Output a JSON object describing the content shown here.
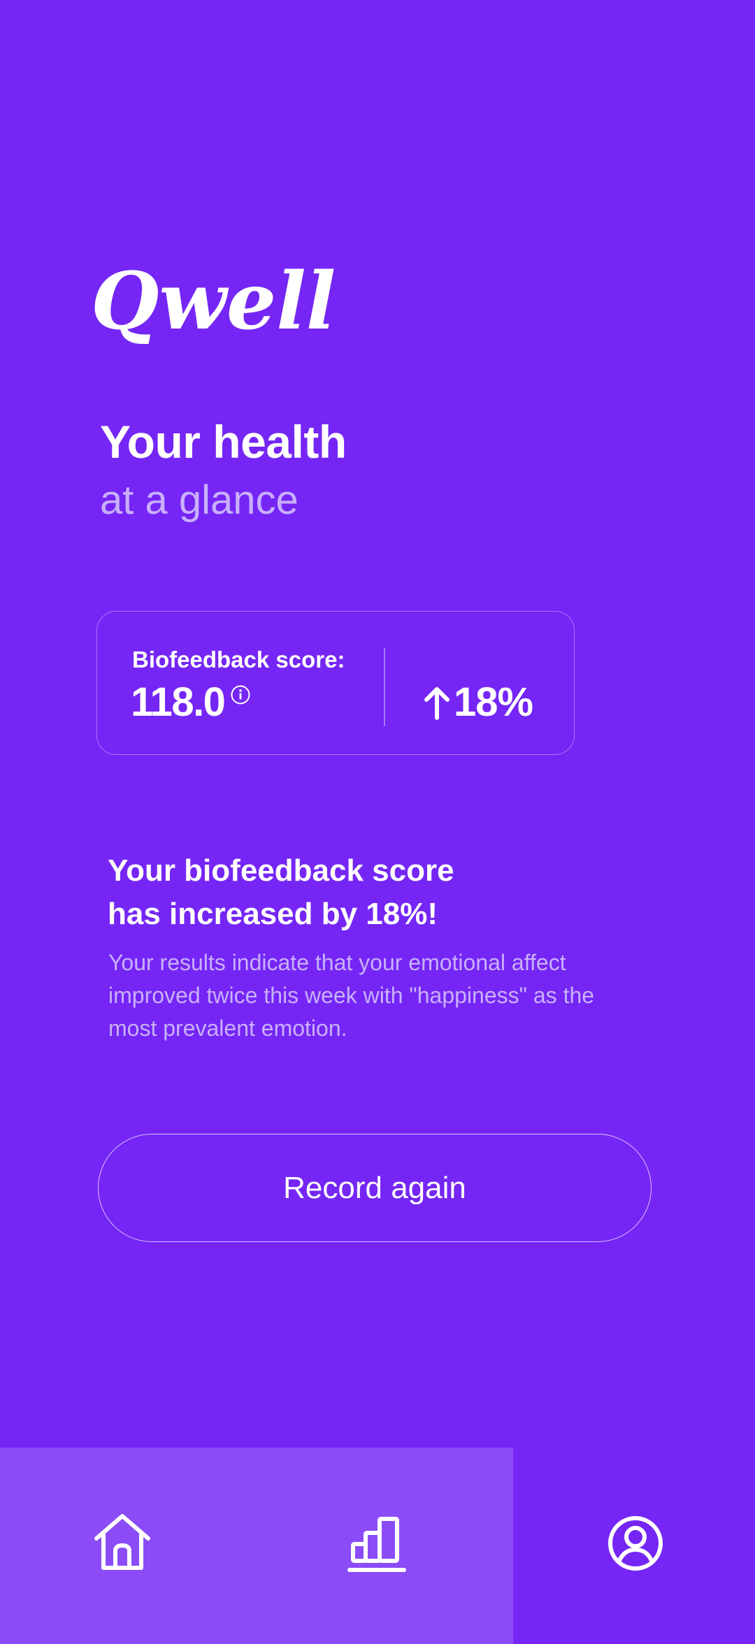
{
  "brand": {
    "logo_text": "Qwell"
  },
  "header": {
    "title": "Your health",
    "subtitle": "at a glance"
  },
  "score_card": {
    "label": "Biofeedback score:",
    "value": "118.0",
    "change": "18%",
    "change_direction": "up",
    "info_icon": "info-icon"
  },
  "result": {
    "title_line1": "Your biofeedback score",
    "title_line2": "has increased by 18%!",
    "description": "Your results indicate that your emotional affect improved twice this week with \"happiness\" as the most prevalent emotion."
  },
  "actions": {
    "record_again_label": "Record again"
  },
  "nav": {
    "items": [
      {
        "icon": "home-icon",
        "active": true
      },
      {
        "icon": "bar-chart-icon",
        "active": true
      },
      {
        "icon": "profile-icon",
        "active": false
      }
    ]
  },
  "colors": {
    "background": "#7526F5",
    "nav_highlight": "#8B4CF7",
    "muted_text": "#C9B0FB",
    "text": "#FFFFFF"
  }
}
